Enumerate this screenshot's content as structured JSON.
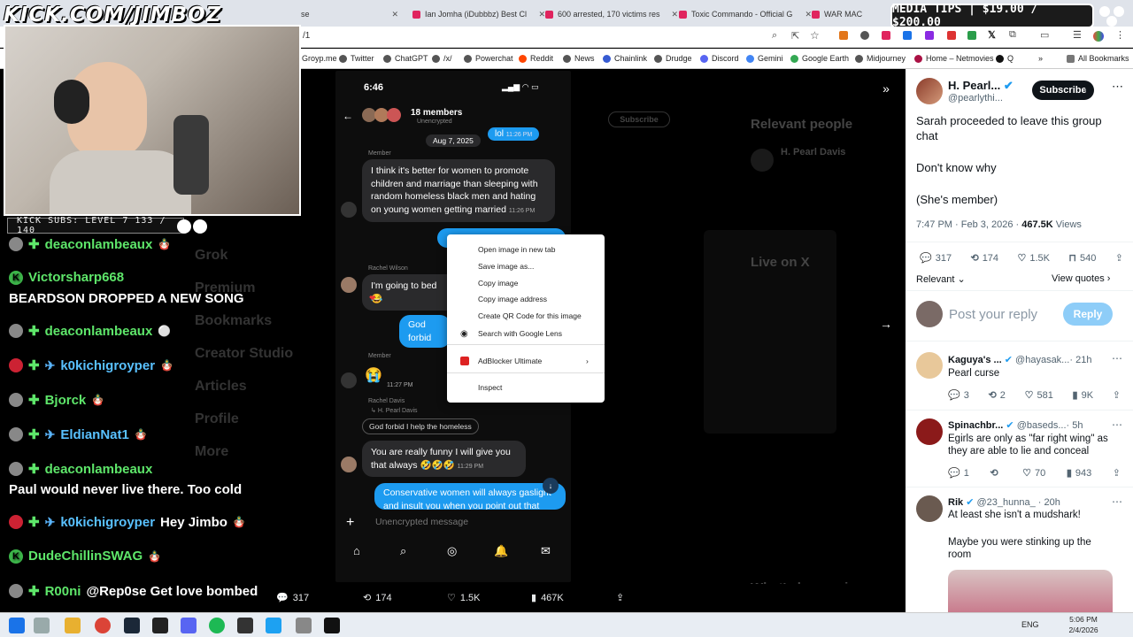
{
  "browser": {
    "tabs": [
      {
        "title": "se"
      },
      {
        "title": "Ian Jomha (iDubbbz) Best Cl"
      },
      {
        "title": "600 arrested, 170 victims res"
      },
      {
        "title": "Toxic Commando - Official G"
      },
      {
        "title": "WAR MAC"
      }
    ],
    "address": "/1",
    "bookmarks": [
      "Groyp.me",
      "Twitter",
      "ChatGPT",
      "/x/",
      "Powerchat",
      "Reddit",
      "News",
      "Chainlink",
      "Drudge",
      "Discord",
      "Gemini",
      "Google Earth",
      "Midjourney",
      "Home – Netmovies",
      "Q",
      "All Bookmarks"
    ]
  },
  "overlay": {
    "kick_url": "KICK.COM/JIMBOZ",
    "media_tips": "MEDIA TIPS | $19.00 / $200.00",
    "subs": "KICK SUBS: LEVEL 7 133 / 140"
  },
  "chat": [
    {
      "user": "deaconlambeaux",
      "text": "",
      "color": "green",
      "badge": "plus"
    },
    {
      "user": "Victorsharp668",
      "text": "",
      "color": "green",
      "badge": "k"
    },
    {
      "user": "",
      "text": "BEARDSON DROPPED A NEW SONG",
      "color": "white",
      "badge": ""
    },
    {
      "user": "deaconlambeaux",
      "text": "",
      "color": "green",
      "badge": "plus"
    },
    {
      "user": "k0kichigroyper",
      "text": "",
      "color": "blue",
      "badge": "sword"
    },
    {
      "user": "Bjorck",
      "text": "",
      "color": "green",
      "badge": "plus"
    },
    {
      "user": "EldianNat1",
      "text": "",
      "color": "blue",
      "badge": "sword"
    },
    {
      "user": "deaconlambeaux",
      "text": "",
      "color": "green",
      "badge": "plus"
    },
    {
      "user": "",
      "text": "Paul would never live there. Too cold",
      "color": "white",
      "badge": ""
    },
    {
      "user": "k0kichigroyper",
      "text": "Hey Jimbo",
      "color": "blue",
      "badge": "sword"
    },
    {
      "user": "DudeChillinSWAG",
      "text": "",
      "color": "green",
      "badge": "k"
    },
    {
      "user": "R00ni",
      "text": "@Rep0se Get love bombed",
      "color": "green",
      "badge": "plus"
    }
  ],
  "left_nav": [
    "Grok",
    "Premium",
    "Bookmarks",
    "Creator Studio",
    "Articles",
    "Profile",
    "More"
  ],
  "phone": {
    "clock": "6:46",
    "group": "18 members",
    "encryption": "Unencrypted",
    "date": "Aug 7, 2025",
    "member_label": "Member",
    "msg_lol": "lol",
    "msg_lol_time": "11:26 PM",
    "msg1": "I think it's better for women to promote children and marriage than sleeping with random homeless black men and hating on young women getting married",
    "msg1_time": "11:26 PM",
    "sender2": "Rachel Wilson",
    "msg2": "I'm going to bed 😂",
    "msg3": "God forbid",
    "member2": "Member",
    "msg4_time": "11:27 PM",
    "sender3": "Rachel Davis",
    "reply_to": "H. Pearl Davis",
    "quoted": "God forbid I help the homeless",
    "msg5": "You are really funny I will give you that always 🤣🤣🤣",
    "msg5_time": "11:29 PM",
    "msg6": "Conservative women will always gaslight and insult you when you point out that they",
    "composer": "Unencrypted message"
  },
  "context_menu": [
    "Open image in new tab",
    "Save image as...",
    "Copy image",
    "Copy image address",
    "Create QR Code for this image",
    "Search with Google Lens",
    "AdBlocker Ultimate",
    "Inspect"
  ],
  "dim_panel": {
    "subscribe": "Subscribe",
    "relevant": "Relevant people",
    "person": "H. Pearl Davis",
    "live": "Live on X",
    "whats": "What's happening"
  },
  "post": {
    "author": "H. Pearl...",
    "handle": "@pearlythi...",
    "subscribe": "Subscribe",
    "text1": "Sarah proceeded to leave this group chat",
    "text2": "Don't know why",
    "text3": "(She's member)",
    "meta": "7:47 PM · Feb 3, 2026 ·",
    "views": "467.5K",
    "views_label": "Views",
    "replies": "317",
    "reposts": "174",
    "likes": "1.5K",
    "bookmarks": "540",
    "sort": "Relevant",
    "view_quotes": "View quotes",
    "reply_placeholder": "Post your reply",
    "reply_btn": "Reply"
  },
  "replies": [
    {
      "name": "Kaguya's ...",
      "handle": "@hayasak...",
      "time": "· 21h",
      "text": "Pearl curse",
      "c": "3",
      "r": "2",
      "l": "581",
      "v": "9K"
    },
    {
      "name": "Spinachbr...",
      "handle": "@baseds...",
      "time": "· 5h",
      "text": "Egirls are only as \"far right wing\" as they are able to lie and conceal",
      "c": "1",
      "r": "",
      "l": "70",
      "v": "943"
    },
    {
      "name": "Rik",
      "handle": "@23_hunna_",
      "time": "· 20h",
      "text": "At least she isn't a mudshark!",
      "text2": "Maybe you were stinking up the room"
    }
  ],
  "stats": {
    "replies": "317",
    "reposts": "174",
    "likes": "1.5K",
    "views": "467K"
  },
  "taskbar": {
    "lang": "ENG",
    "time": "5:06 PM",
    "date": "2/4/2026"
  }
}
